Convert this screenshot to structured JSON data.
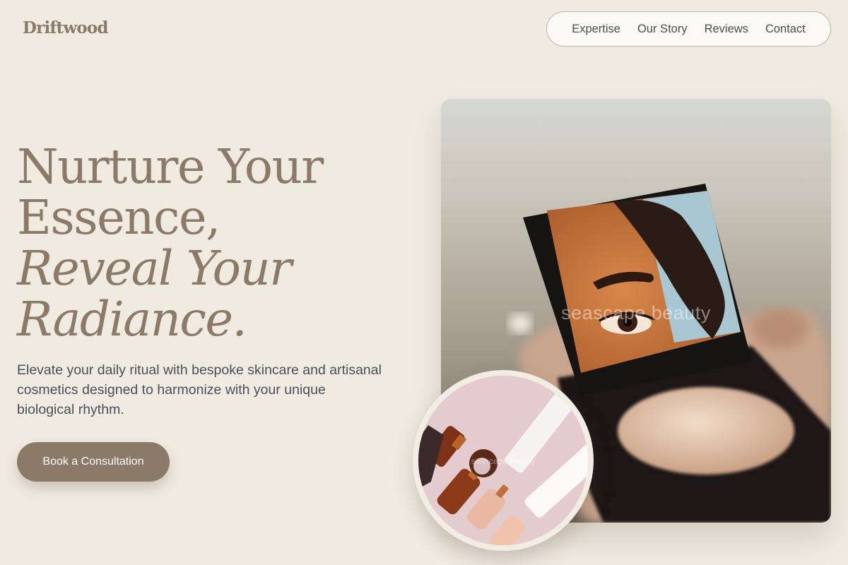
{
  "brand": {
    "name": "Driftwood"
  },
  "nav": {
    "items": [
      {
        "label": "Expertise"
      },
      {
        "label": "Our Story"
      },
      {
        "label": "Reviews"
      },
      {
        "label": "Contact"
      }
    ]
  },
  "hero": {
    "title_line1": "Nurture Your",
    "title_line2": "Essence,",
    "title_line3": "Reveal Your",
    "title_line4": "Radiance.",
    "description": "Elevate your daily ritual with bespoke skincare and artisanal cosmetics designed to harmonize with your unique biological rhythm.",
    "cta_label": "Book a Consultation"
  },
  "images": {
    "main_watermark": "seascape beauty",
    "secondary_watermark": "seascape beauty"
  },
  "colors": {
    "background": "#f0ebe1",
    "accent": "#8c7a68",
    "text": "#4a4f5c"
  }
}
